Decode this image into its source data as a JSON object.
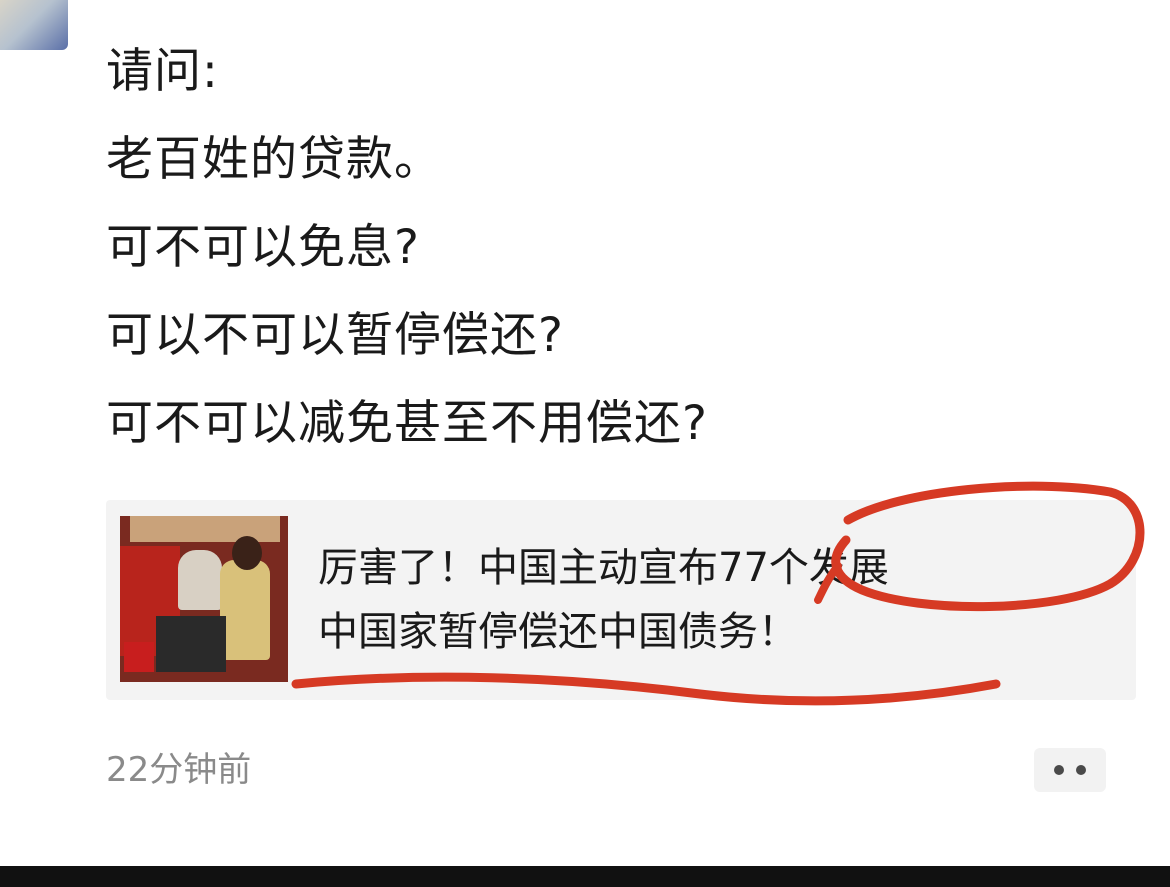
{
  "post": {
    "lines": [
      "请问:",
      "老百姓的贷款。",
      "可不可以免息?",
      "可以不可以暂停偿还?",
      "可不可以减免甚至不用偿还?"
    ]
  },
  "link_card": {
    "title_line_1": "厉害了！中国主动宣布77个发展",
    "title_line_2": "中国家暂停偿还中国债务！"
  },
  "meta": {
    "timestamp": "22分钟前"
  },
  "colors": {
    "annotation": "#d63a24",
    "text": "#1a1a1a",
    "muted": "#8a8a8a",
    "card_bg": "#f3f3f3"
  },
  "icons": {
    "more": "more-dots-icon"
  }
}
